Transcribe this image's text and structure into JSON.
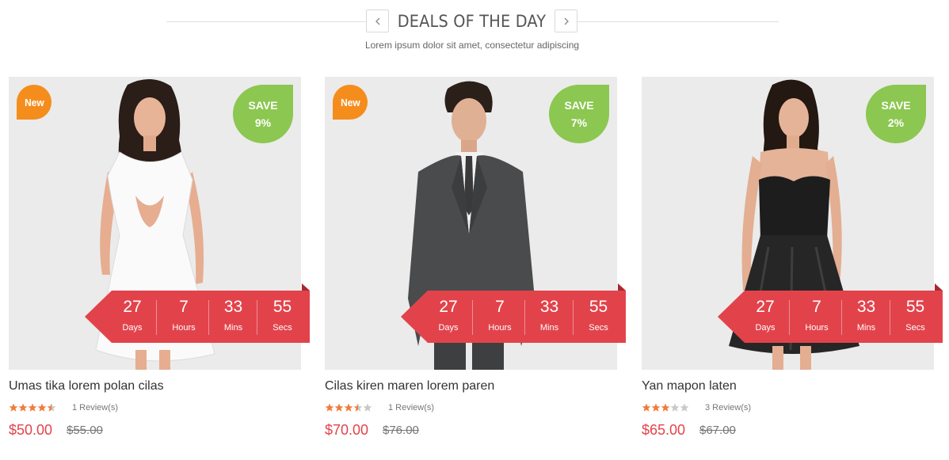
{
  "header": {
    "title": "DEALS OF THE DAY",
    "subtitle": "Lorem ipsum dolor sit amet, consectetur adipiscing",
    "prev_icon": "chevron-left-icon",
    "next_icon": "chevron-right-icon"
  },
  "colors": {
    "accent_red": "#e2434b",
    "new_badge": "#f58d1c",
    "save_badge": "#8cc751",
    "star_filled": "#f07c3c",
    "star_empty": "#c8c8c8"
  },
  "products": [
    {
      "badge_new": "New",
      "save_label": "SAVE",
      "save_value": "9%",
      "countdown": [
        {
          "value": "27",
          "label": "Days"
        },
        {
          "value": "7",
          "label": "Hours"
        },
        {
          "value": "33",
          "label": "Mins"
        },
        {
          "value": "55",
          "label": "Secs"
        }
      ],
      "title": "Umas tika lorem polan cilas",
      "rating": 4.5,
      "reviews": "1 Review(s)",
      "price": "$50.00",
      "old_price": "$55.00"
    },
    {
      "badge_new": "New",
      "save_label": "SAVE",
      "save_value": "7%",
      "countdown": [
        {
          "value": "27",
          "label": "Days"
        },
        {
          "value": "7",
          "label": "Hours"
        },
        {
          "value": "33",
          "label": "Mins"
        },
        {
          "value": "55",
          "label": "Secs"
        }
      ],
      "title": "Cilas kiren maren lorem paren",
      "rating": 3.5,
      "reviews": "1 Review(s)",
      "price": "$70.00",
      "old_price": "$76.00"
    },
    {
      "badge_new": "",
      "save_label": "SAVE",
      "save_value": "2%",
      "countdown": [
        {
          "value": "27",
          "label": "Days"
        },
        {
          "value": "7",
          "label": "Hours"
        },
        {
          "value": "33",
          "label": "Mins"
        },
        {
          "value": "55",
          "label": "Secs"
        }
      ],
      "title": "Yan mapon laten",
      "rating": 3,
      "reviews": "3 Review(s)",
      "price": "$65.00",
      "old_price": "$67.00"
    }
  ]
}
